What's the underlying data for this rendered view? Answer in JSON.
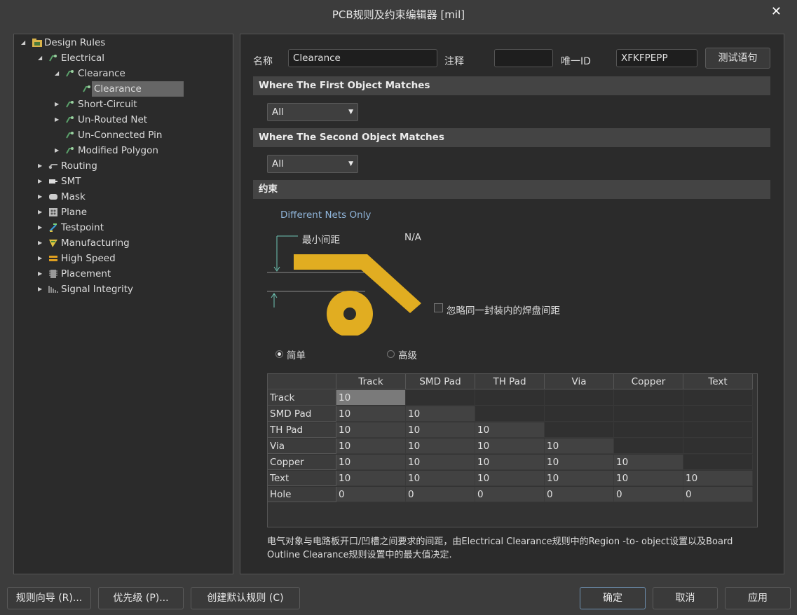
{
  "window": {
    "title": "PCB规则及约束编辑器 [mil]",
    "close": "✕"
  },
  "tree": {
    "root": "Design Rules",
    "electrical": "Electrical",
    "clearance_group": "Clearance",
    "clearance_rule": "Clearance",
    "short_circuit": "Short-Circuit",
    "unrouted_net": "Un-Routed Net",
    "unconnected_pin": "Un-Connected Pin",
    "modified_polygon": "Modified Polygon",
    "routing": "Routing",
    "smt": "SMT",
    "mask": "Mask",
    "plane": "Plane",
    "testpoint": "Testpoint",
    "manufacturing": "Manufacturing",
    "high_speed": "High Speed",
    "placement": "Placement",
    "signal_integrity": "Signal Integrity"
  },
  "rule": {
    "name_label": "名称",
    "name_value": "Clearance",
    "comment_label": "注释",
    "comment_value": "",
    "uid_label": "唯一ID",
    "uid_value": "XFKFPEPP",
    "test_button": "测试语句"
  },
  "first_match": {
    "title": "Where The First Object Matches",
    "selected": "All"
  },
  "second_match": {
    "title": "Where The Second Object Matches",
    "selected": "All"
  },
  "constraints": {
    "title": "约束",
    "net_scope": "Different Nets Only",
    "min_clearance_label": "最小间距",
    "min_clearance_value": "N/A",
    "ignore_pad_label": "忽略同一封装内的焊盘间距",
    "mode_simple": "简单",
    "mode_advanced": "高级"
  },
  "grid": {
    "columns": [
      "Track",
      "SMD Pad",
      "TH Pad",
      "Via",
      "Copper",
      "Text"
    ],
    "rows": [
      {
        "label": "Track",
        "values": [
          "10",
          "",
          "",
          "",
          "",
          ""
        ]
      },
      {
        "label": "SMD Pad",
        "values": [
          "10",
          "10",
          "",
          "",
          "",
          ""
        ]
      },
      {
        "label": "TH Pad",
        "values": [
          "10",
          "10",
          "10",
          "",
          "",
          ""
        ]
      },
      {
        "label": "Via",
        "values": [
          "10",
          "10",
          "10",
          "10",
          "",
          ""
        ]
      },
      {
        "label": "Copper",
        "values": [
          "10",
          "10",
          "10",
          "10",
          "10",
          ""
        ]
      },
      {
        "label": "Text",
        "values": [
          "10",
          "10",
          "10",
          "10",
          "10",
          "10"
        ]
      },
      {
        "label": "Hole",
        "values": [
          "0",
          "0",
          "0",
          "0",
          "0",
          "0"
        ]
      }
    ]
  },
  "description": "电气对象与电路板开口/凹槽之间要求的间距，由Electrical Clearance规则中的Region -to- object设置以及Board Outline Clearance规则设置中的最大值决定.",
  "footer": {
    "rule_wizard": "规则向导 (R)...",
    "priorities": "优先级 (P)...",
    "create_default": "创建默认规则 (C)",
    "ok": "确定",
    "cancel": "取消",
    "apply": "应用"
  },
  "colors": {
    "copper_shape": "#e1ad21",
    "panel_bg": "#2b2b2b",
    "window_bg": "#3c3c3c"
  }
}
